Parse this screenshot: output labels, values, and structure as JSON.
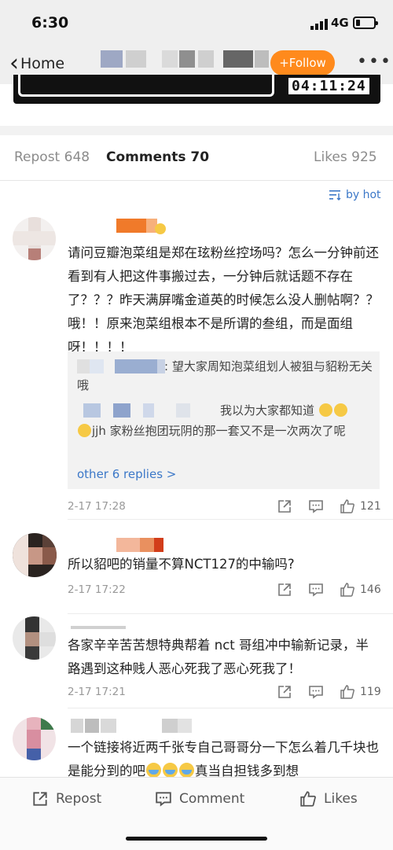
{
  "status_bar": {
    "time": "6:30",
    "network": "4G"
  },
  "nav": {
    "back_label": "Home",
    "follow_label": "+Follow",
    "more_label": "•••"
  },
  "video": {
    "ticker": "04:11:24"
  },
  "tabs": [
    {
      "label": "Repost 648",
      "active": false
    },
    {
      "label": "Comments 70",
      "active": true
    },
    {
      "label": "Likes 925",
      "active": false
    }
  ],
  "sort": {
    "label": "by hot"
  },
  "comments": [
    {
      "text": "请问豆瓣泡菜组是郑在玹粉丝控场吗？怎么一分钟前还看到有人把这件事搬过去，一分钟后就话题不存在了？？？昨天满屏嘴金道英的时候怎么没人删帖啊？？哦！！原来泡菜组根本不是所谓的叁组，而是面组呀！！！！",
      "date": "2-17 17:28",
      "likes": "121",
      "replies": {
        "reply1": ": 望大家周知泡菜组划人被狙与貂粉无关哦",
        "reply2a": "我以为大家都知道",
        "reply2b": "jjh 家粉丝抱团玩阴的那一套又不是一次两次了呢",
        "more": "other 6 replies >"
      }
    },
    {
      "text": "所以貂吧的销量不算NCT127的中输吗?",
      "date": "2-17 17:22",
      "likes": "146"
    },
    {
      "text": "各家辛辛苦苦想特典帮着 nct 哥组冲中输新记录，半路遇到这种贱人恶心死我了恶心死我了！",
      "date": "2-17 17:21",
      "likes": "119"
    },
    {
      "text": "一个链接将近两千张专自己哥哥分一下怎么着几千块也是能分到的吧",
      "text_tail": "真当自担钱多到想"
    }
  ],
  "bottom_bar": {
    "repost": "Repost",
    "comment": "Comment",
    "likes": "Likes"
  },
  "colors": {
    "accent_orange": "#ff8a1c",
    "link_blue": "#3c78c8"
  }
}
